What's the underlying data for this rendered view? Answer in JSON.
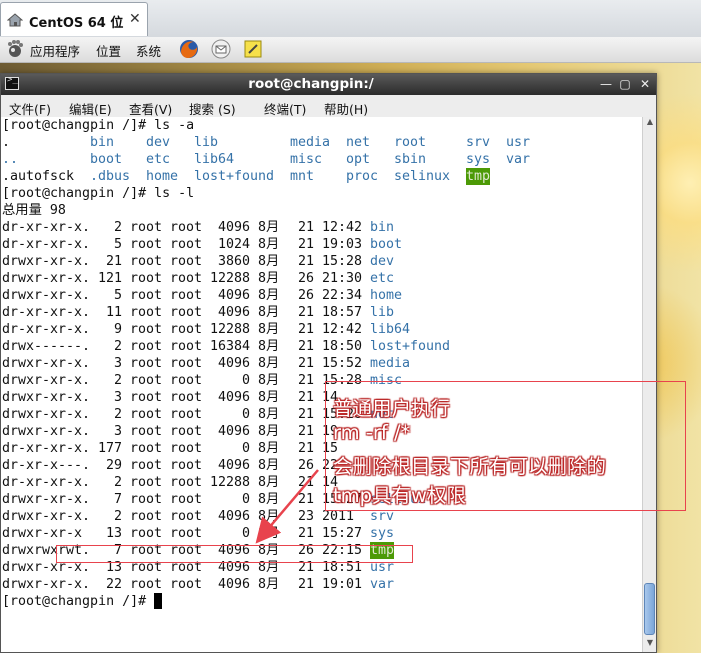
{
  "vm_tab": {
    "title": "CentOS 64 位",
    "close_glyph": "✕"
  },
  "panel": {
    "applications": "应用程序",
    "places": "位置",
    "system": "系统",
    "icons": [
      "gnome-foot-icon",
      "firefox-icon",
      "mail-icon",
      "notes-icon"
    ]
  },
  "terminal": {
    "title": "root@changpin:/",
    "menus": [
      "文件(F)",
      "编辑(E)",
      "查看(V)",
      "搜索 (S)",
      "终端(T)",
      "帮助(H)"
    ],
    "prompt": "[root@changpin /]# ",
    "cmd1": "ls -a",
    "ls_a_rows": [
      [
        ".",
        "bin",
        "dev",
        "lib",
        "media",
        "net",
        "root",
        "srv",
        "usr"
      ],
      [
        "..",
        "boot",
        "etc",
        "lib64",
        "misc",
        "opt",
        "sbin",
        "sys",
        "var"
      ],
      [
        ".autofsck",
        ".dbus",
        "home",
        "lost+found",
        "mnt",
        "proc",
        "selinux",
        "tmp"
      ]
    ],
    "cmd2": "ls -l",
    "total": "总用量 98",
    "ls_l": [
      {
        "perm": "dr-xr-xr-x.",
        "links": "2",
        "owner": "root",
        "group": "root",
        "size": "4096",
        "month": "8月",
        "day": "21",
        "time": "12:42",
        "name": "bin"
      },
      {
        "perm": "dr-xr-xr-x.",
        "links": "5",
        "owner": "root",
        "group": "root",
        "size": "1024",
        "month": "8月",
        "day": "21",
        "time": "19:03",
        "name": "boot"
      },
      {
        "perm": "drwxr-xr-x.",
        "links": "21",
        "owner": "root",
        "group": "root",
        "size": "3860",
        "month": "8月",
        "day": "21",
        "time": "15:28",
        "name": "dev"
      },
      {
        "perm": "drwxr-xr-x.",
        "links": "121",
        "owner": "root",
        "group": "root",
        "size": "12288",
        "month": "8月",
        "day": "26",
        "time": "21:30",
        "name": "etc"
      },
      {
        "perm": "drwxr-xr-x.",
        "links": "5",
        "owner": "root",
        "group": "root",
        "size": "4096",
        "month": "8月",
        "day": "26",
        "time": "22:34",
        "name": "home"
      },
      {
        "perm": "dr-xr-xr-x.",
        "links": "11",
        "owner": "root",
        "group": "root",
        "size": "4096",
        "month": "8月",
        "day": "21",
        "time": "18:57",
        "name": "lib"
      },
      {
        "perm": "dr-xr-xr-x.",
        "links": "9",
        "owner": "root",
        "group": "root",
        "size": "12288",
        "month": "8月",
        "day": "21",
        "time": "12:42",
        "name": "lib64"
      },
      {
        "perm": "drwx------.",
        "links": "2",
        "owner": "root",
        "group": "root",
        "size": "16384",
        "month": "8月",
        "day": "21",
        "time": "18:50",
        "name": "lost+found"
      },
      {
        "perm": "drwxr-xr-x.",
        "links": "3",
        "owner": "root",
        "group": "root",
        "size": "4096",
        "month": "8月",
        "day": "21",
        "time": "15:52",
        "name": "media"
      },
      {
        "perm": "drwxr-xr-x.",
        "links": "2",
        "owner": "root",
        "group": "root",
        "size": "0",
        "month": "8月",
        "day": "21",
        "time": "15:28",
        "name": "misc"
      },
      {
        "perm": "drwxr-xr-x.",
        "links": "3",
        "owner": "root",
        "group": "root",
        "size": "4096",
        "month": "8月",
        "day": "21",
        "time": "14",
        "name": ""
      },
      {
        "perm": "drwxr-xr-x.",
        "links": "2",
        "owner": "root",
        "group": "root",
        "size": "0",
        "month": "8月",
        "day": "21",
        "time": "15:28",
        "name": "net"
      },
      {
        "perm": "drwxr-xr-x.",
        "links": "3",
        "owner": "root",
        "group": "root",
        "size": "4096",
        "month": "8月",
        "day": "21",
        "time": "19",
        "name": ""
      },
      {
        "perm": "dr-xr-xr-x.",
        "links": "177",
        "owner": "root",
        "group": "root",
        "size": "0",
        "month": "8月",
        "day": "21",
        "time": "15",
        "name": ""
      },
      {
        "perm": "dr-xr-x---.",
        "links": "29",
        "owner": "root",
        "group": "root",
        "size": "4096",
        "month": "8月",
        "day": "26",
        "time": "22",
        "name": ""
      },
      {
        "perm": "dr-xr-xr-x.",
        "links": "2",
        "owner": "root",
        "group": "root",
        "size": "12288",
        "month": "8月",
        "day": "21",
        "time": "14",
        "name": ""
      },
      {
        "perm": "drwxr-xr-x.",
        "links": "7",
        "owner": "root",
        "group": "root",
        "size": "0",
        "month": "8月",
        "day": "21",
        "time": "15:27",
        "name": "selinux"
      },
      {
        "perm": "drwxr-xr-x.",
        "links": "2",
        "owner": "root",
        "group": "root",
        "size": "4096",
        "month": "8月",
        "day": "23",
        "time": "2011",
        "name": "srv"
      },
      {
        "perm": "drwxr-xr-x",
        "links": "13",
        "owner": "root",
        "group": "root",
        "size": "0",
        "month": "8月",
        "day": "21",
        "time": "15:27",
        "name": "sys"
      },
      {
        "perm": "drwxrwxrwt.",
        "links": "7",
        "owner": "root",
        "group": "root",
        "size": "4096",
        "month": "8月",
        "day": "26",
        "time": "22:15",
        "name": "tmp"
      },
      {
        "perm": "drwxr-xr-x.",
        "links": "13",
        "owner": "root",
        "group": "root",
        "size": "4096",
        "month": "8月",
        "day": "21",
        "time": "18:51",
        "name": "usr"
      },
      {
        "perm": "drwxr-xr-x.",
        "links": "22",
        "owner": "root",
        "group": "root",
        "size": "4096",
        "month": "8月",
        "day": "21",
        "time": "19:01",
        "name": "var"
      }
    ]
  },
  "annotation": {
    "lines": [
      "普通用户执行",
      "rm -rf /*",
      "会删除根目录下所有可以删除的",
      "tmp具有w权限"
    ],
    "color": "#e8434d"
  },
  "colors": {
    "dir_blue": "#3572a8",
    "tmp_bg": "#4c9a06",
    "titlebar": "#3a3a3a"
  }
}
